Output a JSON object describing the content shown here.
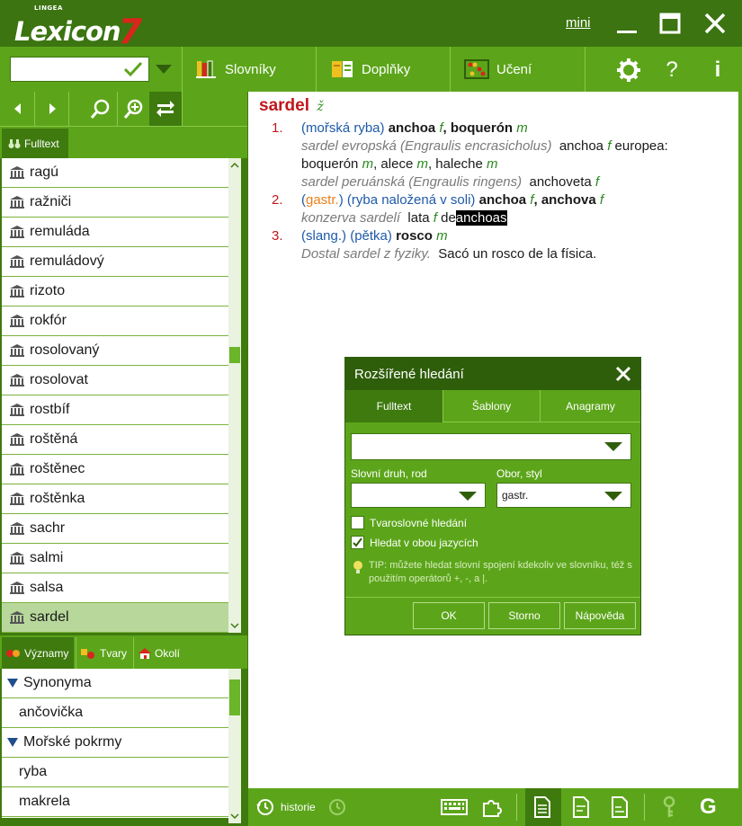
{
  "app": {
    "brand_small": "LINGEA",
    "brand_name": "Lexicon",
    "brand_number": "7",
    "mini_label": "mini"
  },
  "toolbar": {
    "search_value": "",
    "slovniky": "Slovníky",
    "doplnky": "Doplňky",
    "uceni": "Učení",
    "help": "?",
    "info": "i"
  },
  "left": {
    "fulltext_tab": "Fulltext",
    "words": [
      "ragú",
      "ražniči",
      "remuláda",
      "remuládový",
      "rizoto",
      "rokfór",
      "rosolovaný",
      "rosolovat",
      "rostbíf",
      "roštěná",
      "roštěnec",
      "roštěnka",
      "sachr",
      "salmi",
      "salsa",
      "sardel"
    ],
    "selected_word": "sardel",
    "bottom_tabs": [
      "Významy",
      "Tvary",
      "Okolí"
    ],
    "syn_groups": [
      {
        "title": "Synonyma",
        "items": [
          "ančovička"
        ]
      },
      {
        "title": "Mořské pokrmy",
        "items": [
          "ryba",
          "makrela"
        ]
      }
    ]
  },
  "entry": {
    "headword": "sardel",
    "gender": "ž",
    "senses": [
      {
        "num": "1.",
        "label": "(mořská ryba)",
        "t1": "anchoa",
        "g1": "f",
        "t2": "boquerón",
        "g2": "m",
        "ex1_src": "sardel evropská (Engraulis encrasicholus)",
        "ex1_a": "anchoa",
        "ex1_ag": "f",
        "ex1_b": "europea:",
        "ex1_c": "boquerón",
        "ex1_cg": "m",
        "ex1_d": "alece",
        "ex1_dg": "m",
        "ex1_e": "haleche",
        "ex1_eg": "m",
        "ex2_src": "sardel peruánská (Engraulis ringens)",
        "ex2_a": "anchoveta",
        "ex2_ag": "f"
      },
      {
        "num": "2.",
        "domain": "gastr.",
        "label": "(ryba naložená v soli)",
        "t1": "anchoa",
        "g1": "f",
        "t2": "anchova",
        "g2": "f",
        "ex_src": "konzerva sardelí",
        "ex_a": "lata",
        "ex_ag": "f",
        "ex_b": "de",
        "ex_hl": "anchoas"
      },
      {
        "num": "3.",
        "label1": "(slang.)",
        "label2": "(pětka)",
        "t1": "rosco",
        "g1": "m",
        "ex_src": "Dostal sardel z fyziky.",
        "ex_tr": "Sacó un rosco de la física."
      }
    ]
  },
  "dialog": {
    "title": "Rozšířené hledání",
    "tabs": [
      "Fulltext",
      "Šablony",
      "Anagramy"
    ],
    "query_value": "",
    "label_pos": "Slovní druh, rod",
    "pos_value": "",
    "label_field": "Obor, styl",
    "field_value": "gastr.",
    "check1_label": "Tvaroslovné hledání",
    "check1_value": false,
    "check2_label": "Hledat v obou jazycích",
    "check2_value": true,
    "tip": "TIP: můžete hledat slovní spojení kdekoliv ve slovníku, též s použitím operátorů +, -,  a |.",
    "ok": "OK",
    "cancel": "Storno",
    "help": "Nápověda"
  },
  "statusbar": {
    "history": "historie"
  }
}
